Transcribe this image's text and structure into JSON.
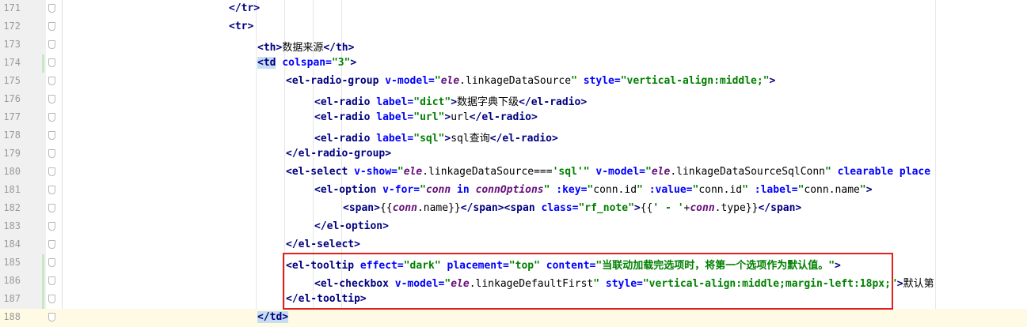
{
  "editor": {
    "lines": [
      {
        "num": "171",
        "parts": [
          {
            "t": "tag",
            "v": "</tr>"
          }
        ],
        "indent": 0
      },
      {
        "num": "172",
        "parts": [
          {
            "t": "tag",
            "v": "<tr>"
          }
        ],
        "indent": 0
      },
      {
        "num": "173",
        "parts": [
          {
            "t": "tag",
            "v": "<th>"
          },
          {
            "t": "txt",
            "v": "数据来源"
          },
          {
            "t": "tag",
            "v": "</th>"
          }
        ],
        "indent": 1
      },
      {
        "num": "174",
        "parts": [
          {
            "t": "tag",
            "v": "<td"
          },
          {
            "t": "sp",
            "v": " "
          },
          {
            "t": "attr",
            "v": "colspan="
          },
          {
            "t": "str",
            "v": "\"3\""
          },
          {
            "t": "tag",
            "v": ">"
          }
        ],
        "indent": 1
      },
      {
        "num": "175",
        "parts": [
          {
            "t": "tag",
            "v": "<el-radio-group"
          },
          {
            "t": "sp",
            "v": " "
          },
          {
            "t": "attr",
            "v": "v-model="
          },
          {
            "t": "str",
            "v": "\""
          },
          {
            "t": "it",
            "v": "ele"
          },
          {
            "t": "plain",
            "v": ".linkageDataSource"
          },
          {
            "t": "str",
            "v": "\""
          },
          {
            "t": "sp",
            "v": " "
          },
          {
            "t": "attr",
            "v": "style="
          },
          {
            "t": "str",
            "v": "\"vertical-align:middle;\""
          },
          {
            "t": "tag",
            "v": ">"
          }
        ],
        "indent": 2
      },
      {
        "num": "176",
        "parts": [
          {
            "t": "tag",
            "v": "<el-radio"
          },
          {
            "t": "sp",
            "v": " "
          },
          {
            "t": "attr",
            "v": "label="
          },
          {
            "t": "str",
            "v": "\"dict\""
          },
          {
            "t": "tag",
            "v": ">"
          },
          {
            "t": "txt",
            "v": "数据字典下级"
          },
          {
            "t": "tag",
            "v": "</el-radio>"
          }
        ],
        "indent": 3
      },
      {
        "num": "177",
        "parts": [
          {
            "t": "tag",
            "v": "<el-radio"
          },
          {
            "t": "sp",
            "v": " "
          },
          {
            "t": "attr",
            "v": "label="
          },
          {
            "t": "str",
            "v": "\"url\""
          },
          {
            "t": "tag",
            "v": ">"
          },
          {
            "t": "txt",
            "v": "url"
          },
          {
            "t": "tag",
            "v": "</el-radio>"
          }
        ],
        "indent": 3
      },
      {
        "num": "178",
        "parts": [
          {
            "t": "tag",
            "v": "<el-radio"
          },
          {
            "t": "sp",
            "v": " "
          },
          {
            "t": "attr",
            "v": "label="
          },
          {
            "t": "str",
            "v": "\"sql\""
          },
          {
            "t": "tag",
            "v": ">"
          },
          {
            "t": "txt",
            "v": "sql查询"
          },
          {
            "t": "tag",
            "v": "</el-radio>"
          }
        ],
        "indent": 3
      },
      {
        "num": "179",
        "parts": [
          {
            "t": "tag",
            "v": "</el-radio-group>"
          }
        ],
        "indent": 2
      },
      {
        "num": "180",
        "parts": [
          {
            "t": "tag",
            "v": "<el-select"
          },
          {
            "t": "sp",
            "v": " "
          },
          {
            "t": "attr",
            "v": "v-show="
          },
          {
            "t": "str",
            "v": "\""
          },
          {
            "t": "it",
            "v": "ele"
          },
          {
            "t": "plain",
            "v": ".linkageDataSource==="
          },
          {
            "t": "str",
            "v": "'sql'\""
          },
          {
            "t": "sp",
            "v": " "
          },
          {
            "t": "attr",
            "v": "v-model="
          },
          {
            "t": "str",
            "v": "\""
          },
          {
            "t": "it",
            "v": "ele"
          },
          {
            "t": "plain",
            "v": ".linkageDataSourceSqlConn"
          },
          {
            "t": "str",
            "v": "\""
          },
          {
            "t": "sp",
            "v": " "
          },
          {
            "t": "attr",
            "v": "clearable place"
          }
        ],
        "indent": 2
      },
      {
        "num": "181",
        "parts": [
          {
            "t": "tag",
            "v": "<el-option"
          },
          {
            "t": "sp",
            "v": " "
          },
          {
            "t": "attr",
            "v": "v-for="
          },
          {
            "t": "str",
            "v": "\""
          },
          {
            "t": "it",
            "v": "conn"
          },
          {
            "t": "plain",
            "v": " "
          },
          {
            "t": "attr",
            "v": "in"
          },
          {
            "t": "plain",
            "v": " "
          },
          {
            "t": "it",
            "v": "connOptions"
          },
          {
            "t": "str",
            "v": "\""
          },
          {
            "t": "sp",
            "v": " "
          },
          {
            "t": "attr",
            "v": ":key="
          },
          {
            "t": "str",
            "v": "\""
          },
          {
            "t": "plain",
            "v": "conn.id"
          },
          {
            "t": "str",
            "v": "\""
          },
          {
            "t": "sp",
            "v": " "
          },
          {
            "t": "attr",
            "v": ":value="
          },
          {
            "t": "str",
            "v": "\""
          },
          {
            "t": "plain",
            "v": "conn.id"
          },
          {
            "t": "str",
            "v": "\""
          },
          {
            "t": "sp",
            "v": " "
          },
          {
            "t": "attr",
            "v": ":label="
          },
          {
            "t": "str",
            "v": "\""
          },
          {
            "t": "plain",
            "v": "conn.name"
          },
          {
            "t": "str",
            "v": "\""
          },
          {
            "t": "tag",
            "v": ">"
          }
        ],
        "indent": 3
      },
      {
        "num": "182",
        "parts": [
          {
            "t": "tag",
            "v": "<span>"
          },
          {
            "t": "plain",
            "v": "{{"
          },
          {
            "t": "it",
            "v": "conn"
          },
          {
            "t": "plain",
            "v": ".name}}"
          },
          {
            "t": "tag",
            "v": "</span><span"
          },
          {
            "t": "sp",
            "v": " "
          },
          {
            "t": "attr",
            "v": "class="
          },
          {
            "t": "str",
            "v": "\"rf_note\""
          },
          {
            "t": "tag",
            "v": ">"
          },
          {
            "t": "plain",
            "v": "{{"
          },
          {
            "t": "str",
            "v": "' - '"
          },
          {
            "t": "plain",
            "v": "+"
          },
          {
            "t": "it",
            "v": "conn"
          },
          {
            "t": "plain",
            "v": ".type}}"
          },
          {
            "t": "tag",
            "v": "</span>"
          }
        ],
        "indent": 4
      },
      {
        "num": "183",
        "parts": [
          {
            "t": "tag",
            "v": "</el-option>"
          }
        ],
        "indent": 3
      },
      {
        "num": "184",
        "parts": [
          {
            "t": "tag",
            "v": "</el-select>"
          }
        ],
        "indent": 2
      },
      {
        "num": "185",
        "parts": [
          {
            "t": "tag",
            "v": "<el-tooltip"
          },
          {
            "t": "sp",
            "v": " "
          },
          {
            "t": "attr",
            "v": "effect="
          },
          {
            "t": "str",
            "v": "\"dark\""
          },
          {
            "t": "sp",
            "v": " "
          },
          {
            "t": "attr",
            "v": "placement="
          },
          {
            "t": "str",
            "v": "\"top\""
          },
          {
            "t": "sp",
            "v": " "
          },
          {
            "t": "attr",
            "v": "content="
          },
          {
            "t": "str",
            "v": "\"当联动加载完选项时，将第一个选项作为默认值。\""
          },
          {
            "t": "tag",
            "v": ">"
          }
        ],
        "indent": 2
      },
      {
        "num": "186",
        "parts": [
          {
            "t": "tag",
            "v": "<el-checkbox"
          },
          {
            "t": "sp",
            "v": " "
          },
          {
            "t": "attr",
            "v": "v-model="
          },
          {
            "t": "str",
            "v": "\""
          },
          {
            "t": "it",
            "v": "ele"
          },
          {
            "t": "plain",
            "v": ".linkageDefaultFirst"
          },
          {
            "t": "str",
            "v": "\""
          },
          {
            "t": "sp",
            "v": " "
          },
          {
            "t": "attr",
            "v": "style="
          },
          {
            "t": "str",
            "v": "\"vertical-align:middle;margin-left:18px;\""
          },
          {
            "t": "tag",
            "v": ">"
          },
          {
            "t": "txt",
            "v": "默认第"
          }
        ],
        "indent": 3
      },
      {
        "num": "187",
        "parts": [
          {
            "t": "tag",
            "v": "</el-tooltip>"
          }
        ],
        "indent": 2
      },
      {
        "num": "188",
        "parts": [
          {
            "t": "tag",
            "v": "</td>"
          }
        ],
        "indent": 1
      }
    ]
  },
  "highlight": {
    "current_line": "188",
    "box_color": "#e0201f"
  }
}
